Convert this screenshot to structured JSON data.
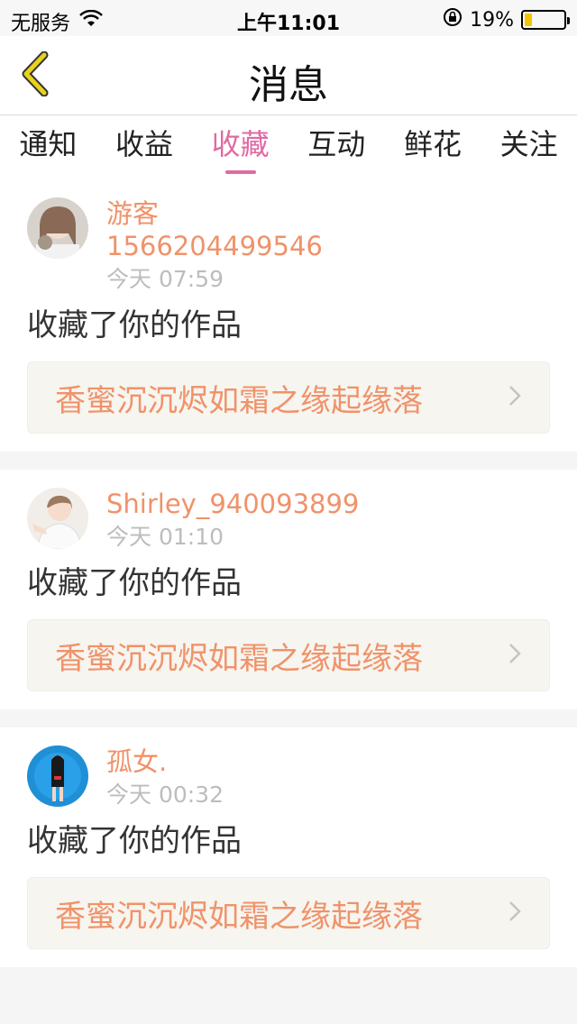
{
  "status_bar": {
    "carrier": "无服务",
    "time": "上午11:01",
    "battery_percent": "19%",
    "battery_level": 0.19,
    "icons": [
      "wifi-icon",
      "rotation-lock-icon",
      "battery-icon"
    ]
  },
  "nav": {
    "title": "消息",
    "back_icon": "back-chevron-icon",
    "accent": "#e0c81a"
  },
  "tabs": [
    {
      "label": "通知",
      "active": false
    },
    {
      "label": "收益",
      "active": false
    },
    {
      "label": "收藏",
      "active": true
    },
    {
      "label": "互动",
      "active": false
    },
    {
      "label": "鲜花",
      "active": false
    },
    {
      "label": "关注",
      "active": false
    }
  ],
  "colors": {
    "active_tab": "#e06aa3",
    "name": "#f0926a",
    "time": "#bdbdbd",
    "link_bg": "#f6f5ef"
  },
  "messages": [
    {
      "name": "游客",
      "sub": "1566204499546",
      "time": "今天 07:59",
      "action": "收藏了你的作品",
      "work": "香蜜沉沉烬如霜之缘起缘落"
    },
    {
      "name": "Shirley_940093899",
      "sub": "",
      "time": "今天 01:10",
      "action": "收藏了你的作品",
      "work": "香蜜沉沉烬如霜之缘起缘落"
    },
    {
      "name": "孤女.",
      "sub": "",
      "time": "今天 00:32",
      "action": "收藏了你的作品",
      "work": "香蜜沉沉烬如霜之缘起缘落"
    }
  ]
}
